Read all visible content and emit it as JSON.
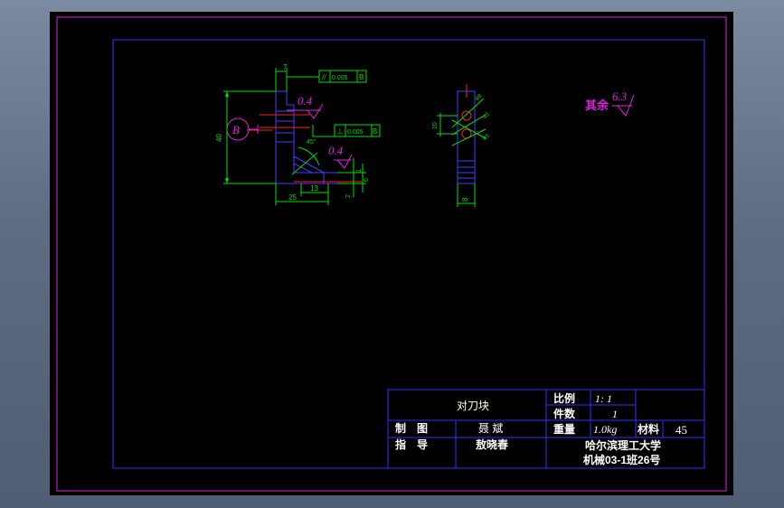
{
  "colors": {
    "frame": "#e020e0",
    "border": "#3030ff",
    "geometry": "#4040ff",
    "dimension": "#00e000",
    "annotation": "#e020e0",
    "title_text": "#ffffff",
    "background": "#000000"
  },
  "drawing": {
    "datum_label": "B",
    "roughness_left_top": "0.4",
    "roughness_left_mid": "0.4",
    "roughness_rest_prefix": "其余",
    "roughness_rest_value": "6.3",
    "tolerance_parallel": {
      "symbol": "//",
      "value": "0.005",
      "datum": "B"
    },
    "tolerance_perpendicular": {
      "symbol": "⊥",
      "value": "0.005",
      "datum": "B"
    },
    "dims_left": {
      "top": "7",
      "height": "40",
      "width": "25",
      "inner": "13",
      "angle": "45°",
      "small_v1": "2",
      "small_v2": "1",
      "small_v3": "6"
    },
    "dims_right": {
      "height": "10",
      "width": "8",
      "hole1": "φ8",
      "hole2": "φ5",
      "hole3": "φ5"
    }
  },
  "title_block": {
    "part_name": "对刀块",
    "scale_label": "比例",
    "scale_value": "1: 1",
    "qty_label": "件数",
    "qty_value": "1",
    "weight_label": "重量",
    "weight_value": "1.0kg",
    "material_label": "材料",
    "material_value": "45",
    "drawn_label": "制　图",
    "drawn_by": "聂 斌",
    "checked_label": "指　导",
    "checked_by": "敖晓春",
    "school": "哈尔滨理工大学",
    "class_no": "机械03-1班26号"
  }
}
